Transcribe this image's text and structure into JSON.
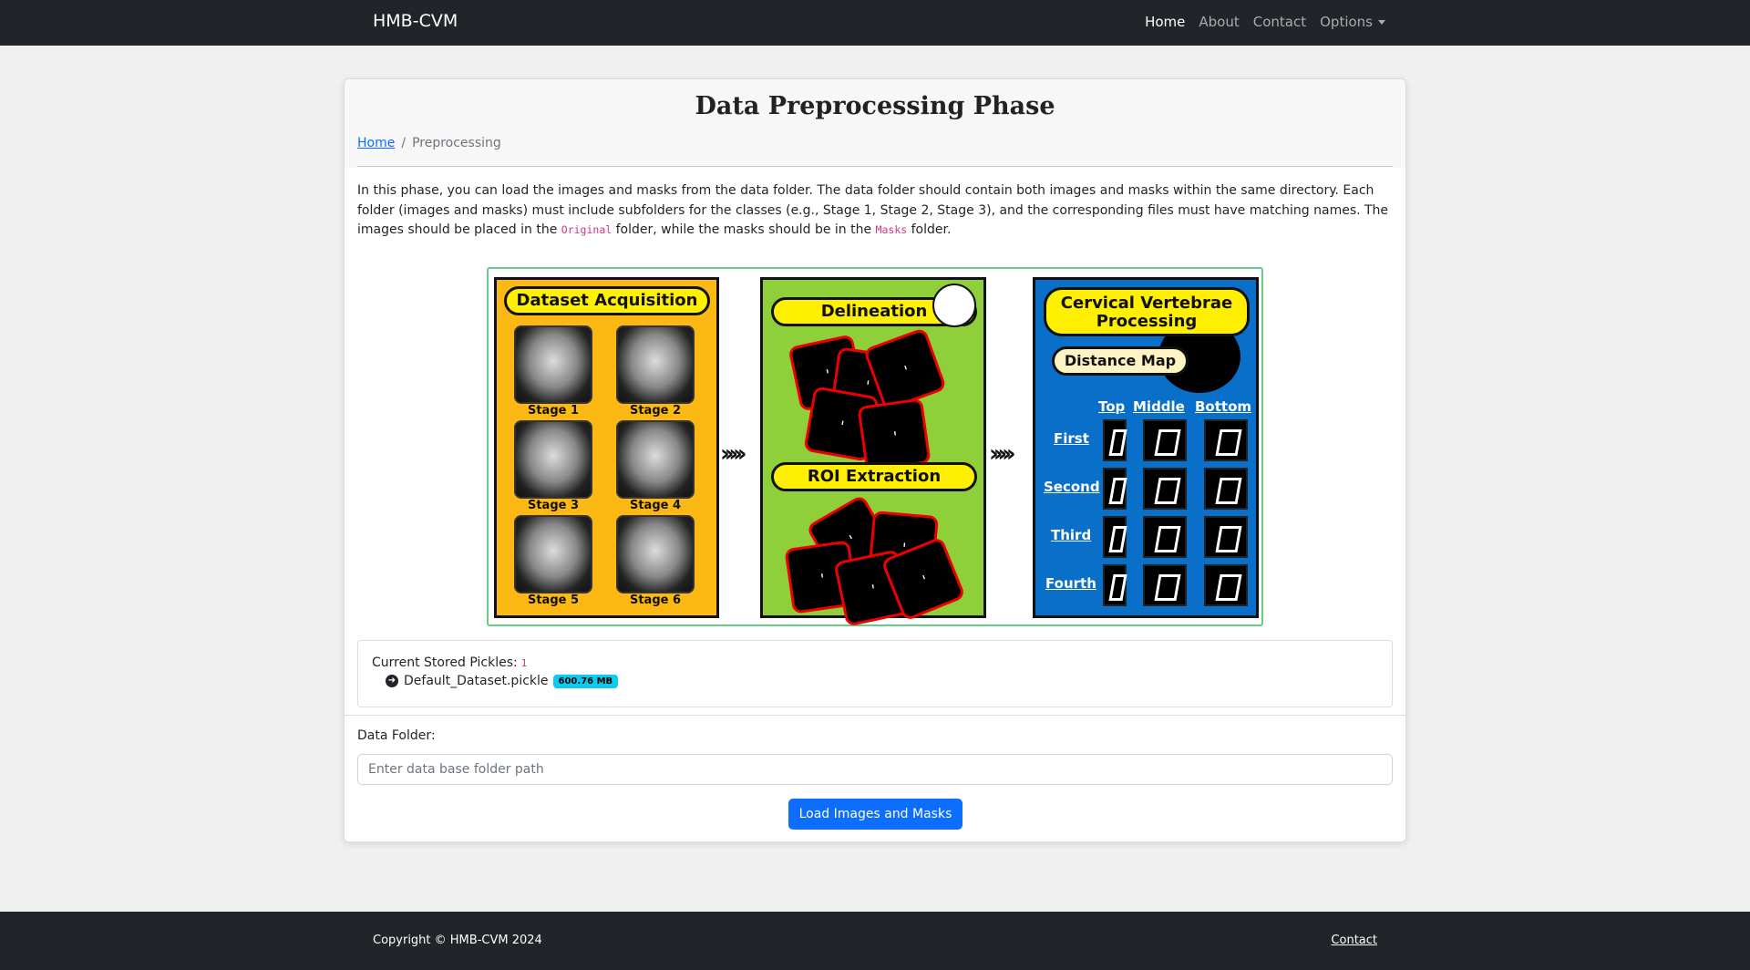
{
  "nav": {
    "brand": "HMB-CVM",
    "links": [
      {
        "label": "Home"
      },
      {
        "label": "About"
      },
      {
        "label": "Contact"
      },
      {
        "label": "Options"
      }
    ]
  },
  "card": {
    "title": "Data Preprocessing Phase",
    "breadcrumb": {
      "home": "Home",
      "separator": "/",
      "current": "Preprocessing"
    },
    "intro": {
      "part1": "In this phase, you can load the images and masks from the data folder. The data folder should contain both images and masks within the same directory. Each folder (images and masks) must include subfolders for the classes (e.g., Stage 1, Stage 2, Stage 3), and the corresponding files must have matching names. The images should be placed in the ",
      "code1": "Original",
      "part2": " folder, while the masks should be in the ",
      "code2": "Masks",
      "part3": " folder."
    },
    "figure": {
      "panel1": {
        "title": "Dataset Acquisition",
        "stages": [
          "Stage 1",
          "Stage 2",
          "Stage 3",
          "Stage 4",
          "Stage 5",
          "Stage 6"
        ]
      },
      "panel2": {
        "title1": "Delineation",
        "title2": "ROI Extraction"
      },
      "panel3": {
        "title": "Cervical Vertebrae Processing",
        "subtitle": "Distance Map",
        "cols": [
          "Top",
          "Middle",
          "Bottom"
        ],
        "rows": [
          "First",
          "Second",
          "Third",
          "Fourth"
        ]
      }
    },
    "pickles": {
      "label": "Current Stored Pickles:",
      "count": "1",
      "items": [
        {
          "name": "Default_Dataset.pickle",
          "size": "600.76 MB",
          "icon": "arrow-circle-right-icon"
        }
      ]
    },
    "form": {
      "label": "Data Folder:",
      "placeholder": "Enter data base folder path",
      "value": "",
      "button": "Load Images and Masks"
    }
  },
  "footer": {
    "copyright": "Copyright © HMB-CVM 2024",
    "contact": "Contact"
  }
}
